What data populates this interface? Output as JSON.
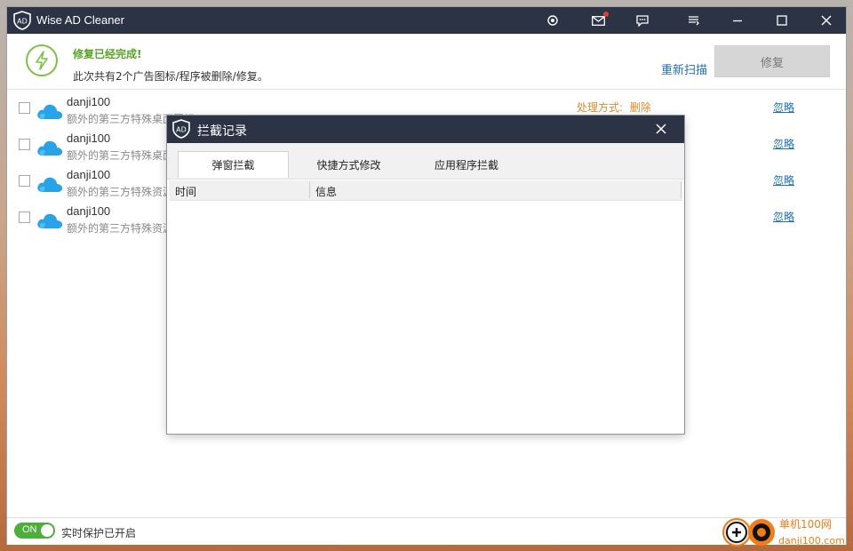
{
  "app": {
    "title": "Wise AD Cleaner"
  },
  "titlebar_icons": [
    "target-icon",
    "mail-icon",
    "feedback-icon",
    "menu-icon",
    "minimize-icon",
    "maximize-icon",
    "close-icon"
  ],
  "banner": {
    "headline": "修复已经完成!",
    "subtext": "此次共有2个广告图标/程序被删除/修复。",
    "rescan_label": "重新扫描",
    "repair_label": "修复"
  },
  "items": [
    {
      "name": "danji100",
      "desc": "额外的第三方特殊桌面图标",
      "method_label": "处理方式:",
      "method_value": "删除",
      "ignore": "忽略"
    },
    {
      "name": "danji100",
      "desc": "额外的第三方特殊桌面图标",
      "ignore": "忽略"
    },
    {
      "name": "danji100",
      "desc": "额外的第三方特殊资源",
      "ignore": "忽略"
    },
    {
      "name": "danji100",
      "desc": "额外的第三方特殊资源",
      "ignore": "忽略"
    }
  ],
  "footer": {
    "toggle_label": "ON",
    "protection_text": "实时保护已开启"
  },
  "dialog": {
    "title": "拦截记录",
    "tabs": [
      "弹窗拦截",
      "快捷方式修改",
      "应用程序拦截"
    ],
    "active_tab": 0,
    "columns": [
      "时间",
      "信息"
    ],
    "rows": []
  },
  "watermark": {
    "site_name": "单机100网",
    "site_url": "danji100.com"
  },
  "colors": {
    "titlebar": "#2c3345",
    "accent_green": "#5aa127",
    "link_blue": "#1d6fb8",
    "method_orange": "#e08a2e"
  }
}
